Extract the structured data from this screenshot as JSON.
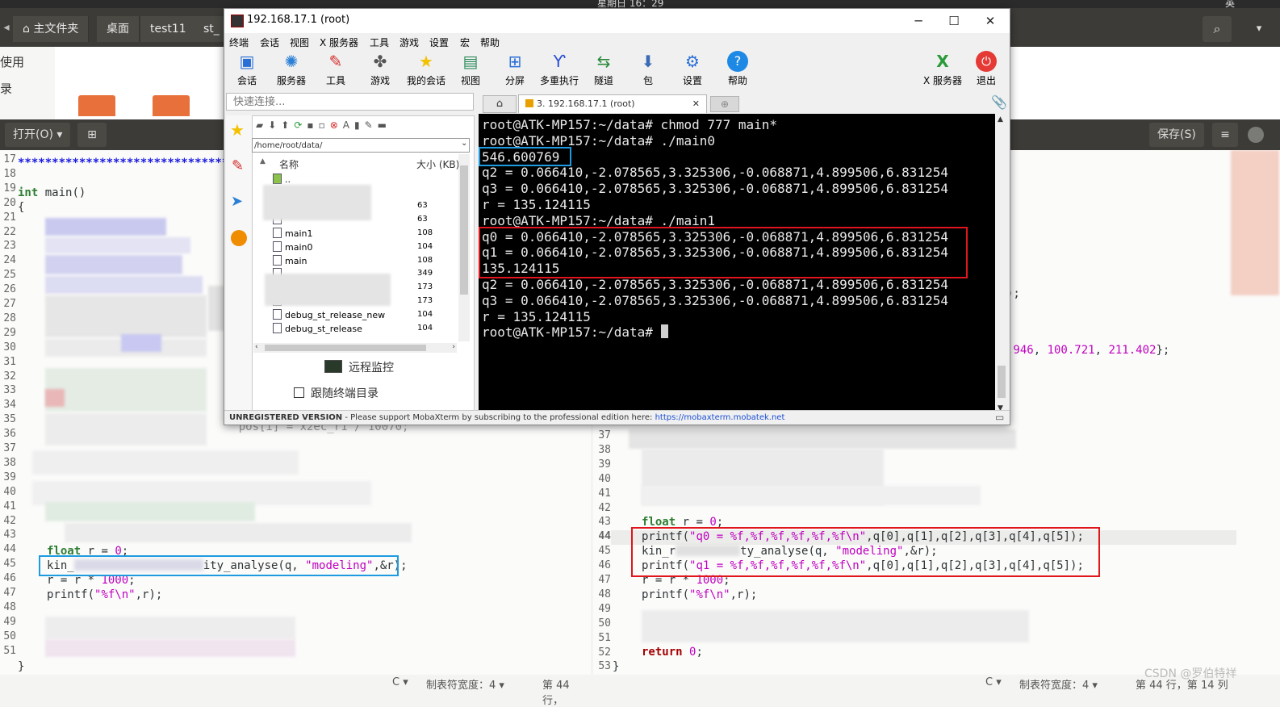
{
  "topbar": {
    "clock": "星期日 16：29",
    "right_menu": "英"
  },
  "nautilus": {
    "crumbs": [
      "主文件夹",
      "桌面",
      "test11",
      "st_"
    ],
    "sidebar": [
      "使用",
      "录"
    ]
  },
  "gedit_left": {
    "open_button": "打开(O)",
    "lines": [
      "17",
      "18",
      "19",
      "20",
      "21",
      "22",
      "23",
      "24",
      "25",
      "26",
      "27",
      "28",
      "29",
      "30",
      "31",
      "32",
      "33",
      "34",
      "35",
      "36",
      "37",
      "38",
      "39",
      "40",
      "41",
      "42",
      "43",
      "44",
      "45",
      "46",
      "47",
      "48",
      "49",
      "50",
      "51"
    ],
    "line17": "***************************************",
    "line19_kw": "int",
    "line19_rest": " main()",
    "line20": "{",
    "line34": "    pos[i] = x2ec_r1 / 10070;",
    "line43_kw": "float",
    "line43_rest": " r = ",
    "line43_num": "0",
    "line44_a": "kin_",
    "line44_b": "ity_analyse(q, ",
    "line44_str": "\"modeling\"",
    "line44_c": ",&r);",
    "line45_a": "r = r * ",
    "line45_num": "1000",
    "line46_a": "printf(",
    "line46_str": "\"%f\\n\"",
    "line46_c": ",r);",
    "line51": "}",
    "status": {
      "lang": "C",
      "tab_width": "制表符宽度：4",
      "position": "第 44 行，"
    }
  },
  "gedit_right": {
    "save_button": "保存(S)",
    "menu_icon": "≡",
    "lines": [
      "37",
      "38",
      "39",
      "40",
      "41",
      "42",
      "43",
      "44",
      "45",
      "46",
      "47",
      "48",
      "49",
      "50",
      "51",
      "52",
      "53"
    ],
    "frag_r1": ");",
    "frag_r2_num1": ".946",
    "frag_r2_sep1": ", ",
    "frag_r2_num2": "100.721",
    "frag_r2_sep2": ", ",
    "frag_r2_num3": "211.402",
    "frag_r2_end": "};",
    "line43_kw": "float",
    "line43_rest": " r = ",
    "line43_num": "0",
    "line44_a": "printf(",
    "line44_str": "\"q0 = %f,%f,%f,%f,%f,%f\\n\"",
    "line44_c": ",q[0],q[1],q[2],q[3],q[4],q[5]);",
    "line45_a": "kin_r",
    "line45_b": "ty_analyse(q, ",
    "line45_str": "\"modeling\"",
    "line45_c": ",&r);",
    "line46_a": "printf(",
    "line46_str": "\"q1 = %f,%f,%f,%f,%f,%f\\n\"",
    "line46_c": ",q[0],q[1],q[2],q[3],q[4],q[5]);",
    "line47_a": "r = r * ",
    "line47_num": "1000",
    "line48_a": "printf(",
    "line48_str": "\"%f\\n\"",
    "line48_c": ",r);",
    "line52_kw": "return",
    "line52_num": "0",
    "line52_end": ";",
    "line53": "}",
    "status": {
      "lang": "C",
      "tab_width": "制表符宽度：4",
      "position": "第 44 行，第 14 列"
    },
    "watermark": "CSDN @罗伯特祥"
  },
  "moba": {
    "title": "192.168.17.1 (root)",
    "menu": [
      "终端",
      "会话",
      "视图",
      "X 服务器",
      "工具",
      "游戏",
      "设置",
      "宏",
      "帮助"
    ],
    "toolbar": [
      "会话",
      "服务器",
      "工具",
      "游戏",
      "我的会话",
      "视图",
      "分屏",
      "多重执行",
      "隧道",
      "包",
      "设置",
      "帮助"
    ],
    "toolbar_right": [
      "X 服务器",
      "退出"
    ],
    "quick_connect_placeholder": "快速连接...",
    "tab_label": "3. 192.168.17.1 (root)",
    "sftp_path": "/home/root/data/",
    "col_name": "名称",
    "col_size": "大小 (KB)",
    "files": [
      {
        "name": "..",
        "size": ""
      },
      {
        "name": "",
        "size": "63"
      },
      {
        "name": "",
        "size": "63"
      },
      {
        "name": "main1",
        "size": "108"
      },
      {
        "name": "main0",
        "size": "104"
      },
      {
        "name": "main",
        "size": "108"
      },
      {
        "name": "",
        "size": "349"
      },
      {
        "name": "",
        "size": "173"
      },
      {
        "name": "",
        "size": "173"
      },
      {
        "name": "debug_st_release_new",
        "size": "104"
      },
      {
        "name": "debug_st_release",
        "size": "104"
      }
    ],
    "remote_monitor": "远程监控",
    "follow_terminal": "跟随终端目录",
    "terminal": [
      "root@ATK-MP157:~/data# chmod 777 main*",
      "root@ATK-MP157:~/data# ./main0",
      "546.600769",
      "q2 = 0.066410,-2.078565,3.325306,-0.068871,4.899506,6.831254",
      "q3 = 0.066410,-2.078565,3.325306,-0.068871,4.899506,6.831254",
      "r = 135.124115",
      "root@ATK-MP157:~/data# ./main1",
      "q0 = 0.066410,-2.078565,3.325306,-0.068871,4.899506,6.831254",
      "q1 = 0.066410,-2.078565,3.325306,-0.068871,4.899506,6.831254",
      "135.124115",
      "q2 = 0.066410,-2.078565,3.325306,-0.068871,4.899506,6.831254",
      "q3 = 0.066410,-2.078565,3.325306,-0.068871,4.899506,6.831254",
      "r = 135.124115",
      "root@ATK-MP157:~/data# "
    ],
    "status_bold": "UNREGISTERED VERSION",
    "status_text": " -  Please support MobaXterm by subscribing to the professional edition here: ",
    "status_link": "https://mobaxterm.mobatek.net"
  },
  "colors": {
    "highlight_red": "#e0161c",
    "highlight_blue": "#1e9be0",
    "keyword": "#2e7d32",
    "string": "#c000c0"
  }
}
